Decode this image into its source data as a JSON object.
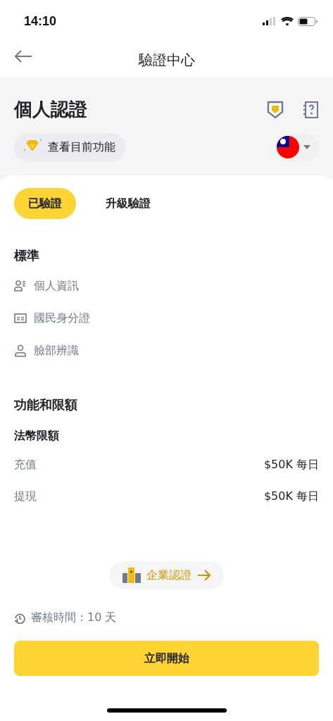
{
  "status_bar": {
    "time": "14:10"
  },
  "header": {
    "title": "驗證中心"
  },
  "profile": {
    "title": "個人認證",
    "features_button": "查看目前功能"
  },
  "tabs": [
    {
      "label": "已驗證",
      "selected": true
    },
    {
      "label": "升級驗證",
      "selected": false
    }
  ],
  "standard": {
    "title": "標準",
    "items": [
      {
        "kind": "info",
        "label": "個人資訊"
      },
      {
        "kind": "idcard",
        "label": "國民身分證"
      },
      {
        "kind": "face",
        "label": "臉部辨識"
      }
    ]
  },
  "limits": {
    "title": "功能和限額",
    "subtitle": "法幣限額",
    "rows": [
      {
        "label": "充值",
        "value": "$50K 每日"
      },
      {
        "label": "提現",
        "value": "$50K 每日"
      }
    ]
  },
  "enterprise_button": "企業認證",
  "review_time": "審核時間：10 天",
  "start_button": "立即開始"
}
